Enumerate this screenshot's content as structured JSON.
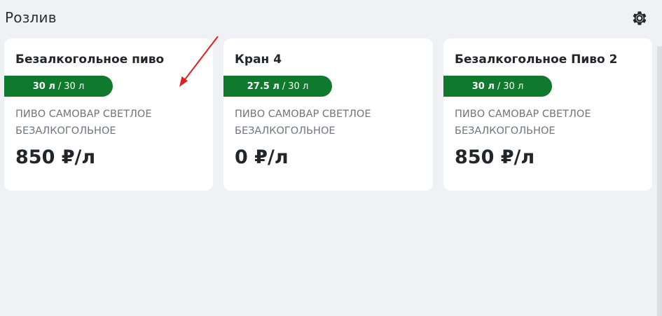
{
  "header": {
    "title": "Розлив",
    "settings_icon": "gear-icon"
  },
  "taps": [
    {
      "name": "Безалкогольное пиво",
      "volume_current": "30 л",
      "volume_separator": "/",
      "volume_total": "30 л",
      "description": "ПИВО САМОВАР СВЕТЛОЕ БЕЗАЛКОГОЛЬНОЕ",
      "price": "850 ₽/л"
    },
    {
      "name": "Кран 4",
      "volume_current": "27.5 л",
      "volume_separator": "/",
      "volume_total": "30 л",
      "description": "ПИВО САМОВАР СВЕТЛОЕ БЕЗАЛКОГОЛЬНОЕ",
      "price": "0 ₽/л"
    },
    {
      "name": "Безалкогольное Пиво 2",
      "volume_current": "30 л",
      "volume_separator": "/",
      "volume_total": "30 л",
      "description": "ПИВО САМОВАР СВЕТЛОЕ БЕЗАЛКОГОЛЬНОЕ",
      "price": "850 ₽/л"
    }
  ],
  "colors": {
    "background": "#f0f1f5",
    "card": "#ffffff",
    "volume_badge": "#0f7a2e",
    "annotation_arrow": "#e02020"
  }
}
